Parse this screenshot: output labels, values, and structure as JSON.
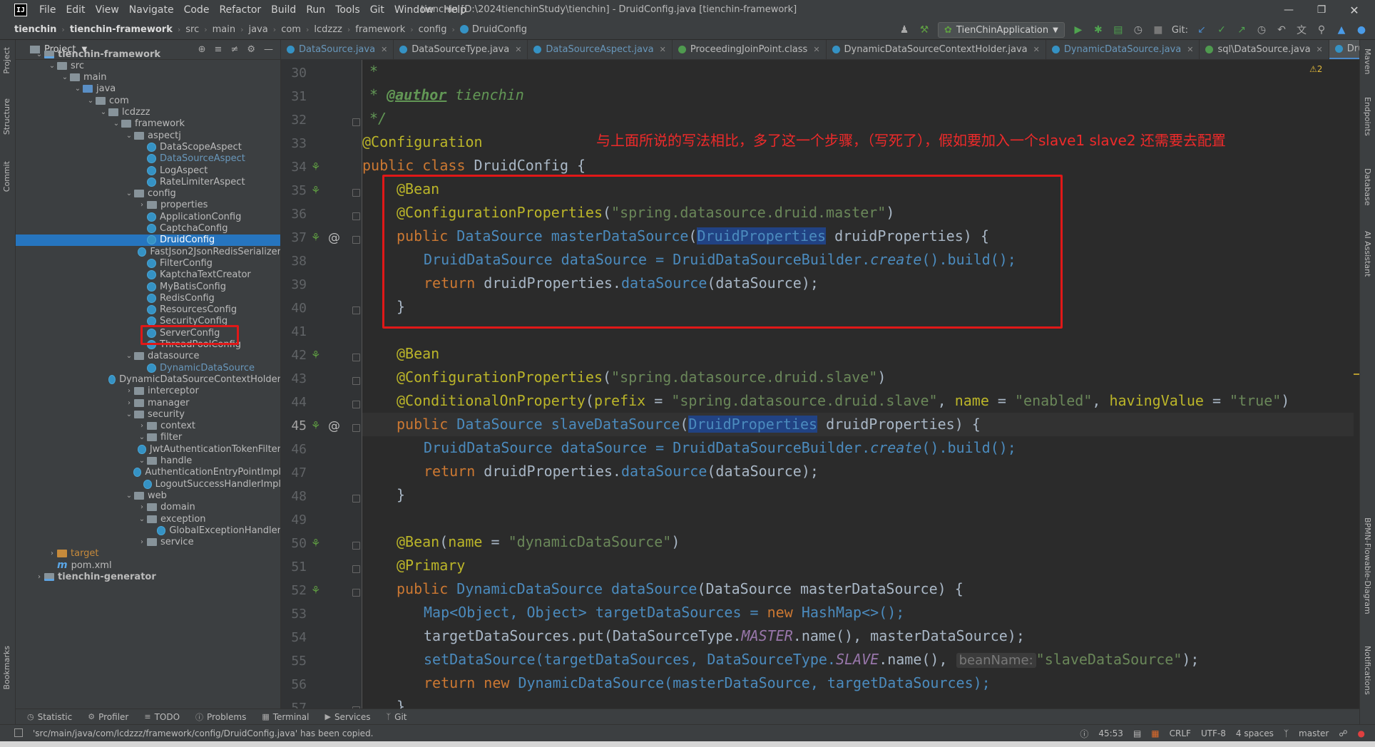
{
  "window": {
    "logo": "IJ",
    "menus": [
      "File",
      "Edit",
      "View",
      "Navigate",
      "Code",
      "Refactor",
      "Build",
      "Run",
      "Tools",
      "Git",
      "Window",
      "Help"
    ],
    "title": "tienchin [D:\\2024tienchinStudy\\tienchin] - DruidConfig.java [tienchin-framework]"
  },
  "navbar": {
    "crumbs": [
      "tienchin",
      "tienchin-framework",
      "src",
      "main",
      "java",
      "com",
      "lcdzzz",
      "framework",
      "config",
      "DruidConfig"
    ],
    "run_config": "TienChinApplication",
    "git_label": "Git:"
  },
  "left_strip": [
    "Project",
    "Structure",
    "Commit",
    "Bookmarks"
  ],
  "right_strip": [
    "Maven",
    "Endpoints",
    "Database",
    "AI Assistant",
    "BPMN-Flowable-Diagram",
    "Notifications"
  ],
  "project": {
    "title": "Project",
    "tree": [
      {
        "label": "tienchin-framework",
        "depth": 1,
        "kind": "module",
        "open": true
      },
      {
        "label": "src",
        "depth": 2,
        "kind": "folder",
        "open": true
      },
      {
        "label": "main",
        "depth": 3,
        "kind": "folder",
        "open": true
      },
      {
        "label": "java",
        "depth": 4,
        "kind": "folder-blue",
        "open": true
      },
      {
        "label": "com",
        "depth": 5,
        "kind": "folder",
        "open": true
      },
      {
        "label": "lcdzzz",
        "depth": 6,
        "kind": "folder",
        "open": true
      },
      {
        "label": "framework",
        "depth": 7,
        "kind": "folder",
        "open": true
      },
      {
        "label": "aspectj",
        "depth": 8,
        "kind": "folder",
        "open": true
      },
      {
        "label": "DataScopeAspect",
        "depth": 9,
        "kind": "class"
      },
      {
        "label": "DataSourceAspect",
        "depth": 9,
        "kind": "class",
        "modified": true
      },
      {
        "label": "LogAspect",
        "depth": 9,
        "kind": "class"
      },
      {
        "label": "RateLimiterAspect",
        "depth": 9,
        "kind": "class"
      },
      {
        "label": "config",
        "depth": 8,
        "kind": "folder",
        "open": true
      },
      {
        "label": "properties",
        "depth": 9,
        "kind": "folder",
        "open": false
      },
      {
        "label": "ApplicationConfig",
        "depth": 9,
        "kind": "class"
      },
      {
        "label": "CaptchaConfig",
        "depth": 9,
        "kind": "class"
      },
      {
        "label": "DruidConfig",
        "depth": 9,
        "kind": "class",
        "selected": true
      },
      {
        "label": "FastJson2JsonRedisSerializer",
        "depth": 9,
        "kind": "class"
      },
      {
        "label": "FilterConfig",
        "depth": 9,
        "kind": "class"
      },
      {
        "label": "KaptchaTextCreator",
        "depth": 9,
        "kind": "class"
      },
      {
        "label": "MyBatisConfig",
        "depth": 9,
        "kind": "class"
      },
      {
        "label": "RedisConfig",
        "depth": 9,
        "kind": "class"
      },
      {
        "label": "ResourcesConfig",
        "depth": 9,
        "kind": "class"
      },
      {
        "label": "SecurityConfig",
        "depth": 9,
        "kind": "class"
      },
      {
        "label": "ServerConfig",
        "depth": 9,
        "kind": "class"
      },
      {
        "label": "ThreadPoolConfig",
        "depth": 9,
        "kind": "class"
      },
      {
        "label": "datasource",
        "depth": 8,
        "kind": "folder",
        "open": true
      },
      {
        "label": "DynamicDataSource",
        "depth": 9,
        "kind": "class",
        "modified": true
      },
      {
        "label": "DynamicDataSourceContextHolder",
        "depth": 9,
        "kind": "class"
      },
      {
        "label": "interceptor",
        "depth": 8,
        "kind": "folder",
        "open": false
      },
      {
        "label": "manager",
        "depth": 8,
        "kind": "folder",
        "open": false
      },
      {
        "label": "security",
        "depth": 8,
        "kind": "folder",
        "open": true
      },
      {
        "label": "context",
        "depth": 9,
        "kind": "folder",
        "open": false
      },
      {
        "label": "filter",
        "depth": 9,
        "kind": "folder",
        "open": true
      },
      {
        "label": "JwtAuthenticationTokenFilter",
        "depth": 10,
        "kind": "class"
      },
      {
        "label": "handle",
        "depth": 9,
        "kind": "folder",
        "open": true
      },
      {
        "label": "AuthenticationEntryPointImpl",
        "depth": 10,
        "kind": "class"
      },
      {
        "label": "LogoutSuccessHandlerImpl",
        "depth": 10,
        "kind": "class"
      },
      {
        "label": "web",
        "depth": 8,
        "kind": "folder",
        "open": true
      },
      {
        "label": "domain",
        "depth": 9,
        "kind": "folder",
        "open": false
      },
      {
        "label": "exception",
        "depth": 9,
        "kind": "folder",
        "open": true
      },
      {
        "label": "GlobalExceptionHandler",
        "depth": 10,
        "kind": "class"
      },
      {
        "label": "service",
        "depth": 9,
        "kind": "folder",
        "open": false
      },
      {
        "label": "target",
        "depth": 2,
        "kind": "folder-orange",
        "open": false,
        "orange": true
      },
      {
        "label": "pom.xml",
        "depth": 2,
        "kind": "maven"
      },
      {
        "label": "tienchin-generator",
        "depth": 1,
        "kind": "module",
        "open": false
      }
    ]
  },
  "tabs": [
    {
      "label": "DataSource.java",
      "modified": true
    },
    {
      "label": "DataSourceType.java"
    },
    {
      "label": "DataSourceAspect.java",
      "modified": true
    },
    {
      "label": "ProceedingJoinPoint.class",
      "green": true
    },
    {
      "label": "DynamicDataSourceContextHolder.java"
    },
    {
      "label": "DynamicDataSource.java",
      "modified": true
    },
    {
      "label": "sql\\DataSource.java",
      "green": true
    },
    {
      "label": "DruidConfig.java",
      "active": true
    }
  ],
  "editor": {
    "warning_count": "⚠2",
    "annotation_note": "与上面所说的写法相比，多了这一个步骤，（写死了），假如要加入一个slave1 slave2 还需要去配置",
    "line_numbers": [
      "30",
      "31",
      "32",
      "33",
      "34",
      "35",
      "36",
      "37",
      "38",
      "39",
      "40",
      "41",
      "42",
      "43",
      "44",
      "45",
      "46",
      "47",
      "48",
      "49",
      "50",
      "51",
      "52",
      "53",
      "54",
      "55",
      "56",
      "57"
    ],
    "current_line": "45",
    "code": {
      "l30": "*",
      "l31_a": "* ",
      "l31_tag": "@author",
      "l31_b": " tienchin",
      "l32": "*/",
      "l33": "@Configuration",
      "l34_kw": "public class ",
      "l34_cls": "DruidConfig {",
      "l35": "@Bean",
      "l36_ann": "@ConfigurationProperties",
      "l36_p1": "(",
      "l36_str": "\"spring.datasource.druid.master\"",
      "l36_p2": ")",
      "l37_kw": "public ",
      "l37_type": "DataSource ",
      "l37_fn": "masterDataSource",
      "l37_p1": "(",
      "l37_arg": "DruidProperties",
      "l37_rest": " druidProperties) {",
      "l38_a": "DruidDataSource dataSource = DruidDataSourceBuilder.",
      "l38_m": "create",
      "l38_b": "().build();",
      "l39_kw": "return ",
      "l39_a": "druidProperties.",
      "l39_m": "dataSource",
      "l39_b": "(dataSource);",
      "l40": "}",
      "l42": "@Bean",
      "l43_ann": "@ConfigurationProperties",
      "l43_p1": "(",
      "l43_str": "\"spring.datasource.druid.slave\"",
      "l43_p2": ")",
      "l44_ann": "@ConditionalOnProperty",
      "l44_p1": "(",
      "l44_k1": "prefix",
      "l44_eq1": " = ",
      "l44_s1": "\"spring.datasource.druid.slave\"",
      "l44_c1": ", ",
      "l44_k2": "name",
      "l44_eq2": " = ",
      "l44_s2": "\"enabled\"",
      "l44_c2": ", ",
      "l44_k3": "havingValue",
      "l44_eq3": " = ",
      "l44_s3": "\"true\"",
      "l44_p2": ")",
      "l45_kw": "public ",
      "l45_type": "DataSource ",
      "l45_fn": "slaveDataSource",
      "l45_p1": "(",
      "l45_arg": "DruidProperties",
      "l45_rest": " druidProperties) {",
      "l46_a": "DruidDataSource dataSource = DruidDataSourceBuilder.",
      "l46_m": "create",
      "l46_b": "().build();",
      "l47_kw": "return ",
      "l47_a": "druidProperties.",
      "l47_m": "dataSource",
      "l47_b": "(dataSource);",
      "l48": "}",
      "l50_ann": "@Bean",
      "l50_p1": "(",
      "l50_k": "name",
      "l50_eq": " = ",
      "l50_str": "\"dynamicDataSource\"",
      "l50_p2": ")",
      "l51": "@Primary",
      "l52_kw": "public ",
      "l52_type": "DynamicDataSource ",
      "l52_fn": "dataSource",
      "l52_rest": "(DataSource masterDataSource) {",
      "l53_a": "Map<Object, Object> targetDataSources = ",
      "l53_kw": "new ",
      "l53_b": "HashMap<>();",
      "l54_a": "targetDataSources.put(DataSourceType.",
      "l54_f": "MASTER",
      "l54_b": ".name(), masterDataSource);",
      "l55_a": "setDataSource(targetDataSources, DataSourceType.",
      "l55_f": "SLAVE",
      "l55_b": ".name(), ",
      "l55_hint": "beanName:",
      "l55_str": "\"slaveDataSource\"",
      "l55_c": ");",
      "l56_kw": "return new ",
      "l56_b": "DynamicDataSource(masterDataSource, targetDataSources);",
      "l57": "}"
    }
  },
  "bottom_tools": [
    "Statistic",
    "Profiler",
    "TODO",
    "Problems",
    "Terminal",
    "Services",
    "Git"
  ],
  "status": {
    "message": "'src/main/java/com/lcdzzz/framework/config/DruidConfig.java' has been copied.",
    "position": "45:53",
    "line_sep": "CRLF",
    "encoding": "UTF-8",
    "indent": "4 spaces",
    "branch": "master"
  }
}
